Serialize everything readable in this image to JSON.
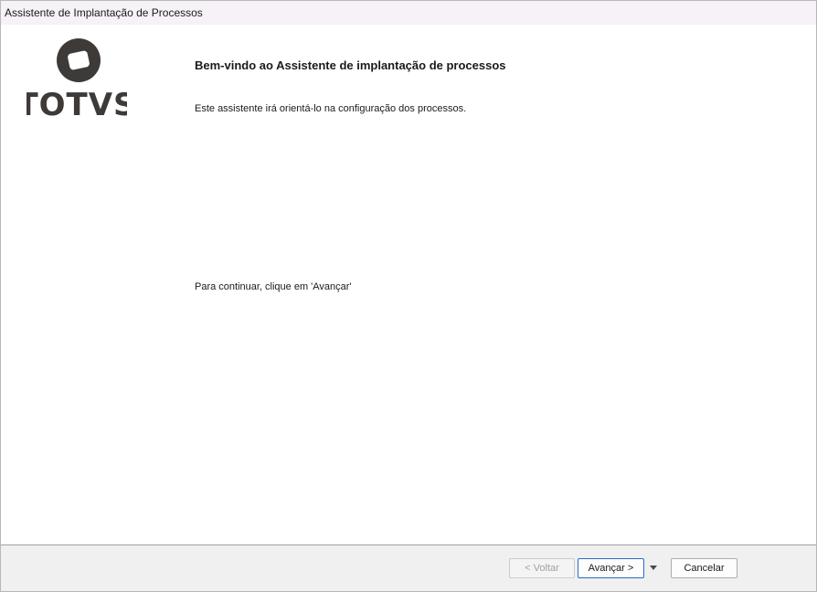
{
  "window": {
    "title": "Assistente de Implantação de Processos"
  },
  "logo": {
    "brand": "TOTVS",
    "color": "#3d3a38"
  },
  "content": {
    "heading": "Bem-vindo ao Assistente de implantação de processos",
    "intro": "Este assistente irá orientá-lo na configuração dos processos.",
    "continue_text": "Para continuar, clique em 'Avançar'"
  },
  "footer": {
    "back_label": "< Voltar",
    "next_label": "Avançar >",
    "cancel_label": "Cancelar",
    "dropdown_icon": "chevron-down-icon"
  }
}
